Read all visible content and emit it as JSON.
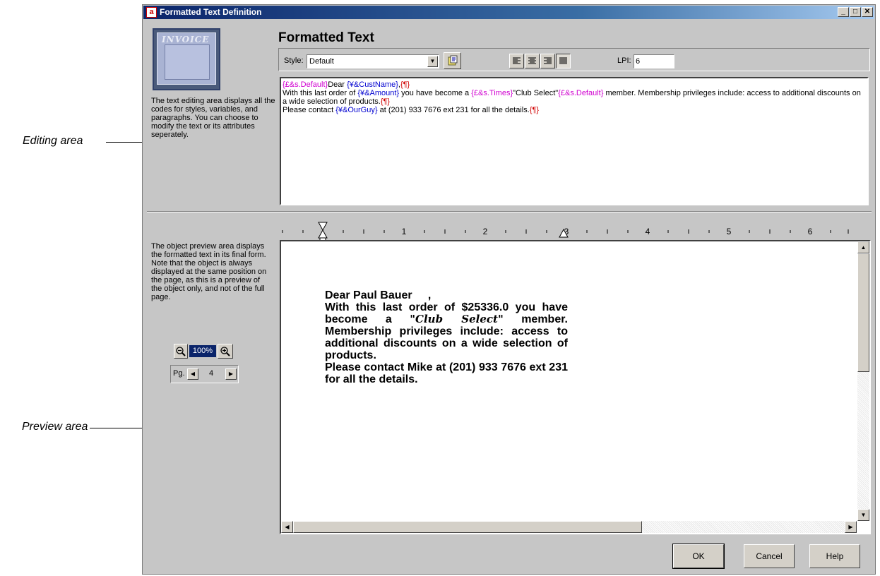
{
  "callouts": {
    "editing_label": "Editing area",
    "preview_label": "Preview area"
  },
  "window": {
    "title": "Formatted Text Definition",
    "controls": {
      "minimize": "_",
      "maximize": "□",
      "close": "✕"
    }
  },
  "thumbnail": {
    "label": "INVOICE"
  },
  "help": {
    "editing_text": "The text editing area displays all the codes for styles, variables, and paragraphs. You can choose to modify the text or its attributes seperately.",
    "preview_text": "The object preview area displays the formatted text in its final form. Note that the object is always displayed at the same position on the page, as this is a preview of the object only, and not of the full page."
  },
  "heading": "Formatted Text",
  "toolbar": {
    "style_label": "Style:",
    "style_value": "Default",
    "lpi_label": "LPI:",
    "lpi_value": "6",
    "align_buttons": [
      "align-left",
      "align-center",
      "align-right",
      "justify"
    ],
    "active_alignment": "justify"
  },
  "editor": {
    "line1": [
      {
        "t": "{£&s.Default}",
        "c": "mag"
      },
      {
        "t": "Dear ",
        "c": "txt"
      },
      {
        "t": "{¥&CustName}",
        "c": "blue"
      },
      {
        "t": ",",
        "c": "txt"
      },
      {
        "t": "{¶}",
        "c": "red"
      }
    ],
    "line2": [
      {
        "t": "With this last order of ",
        "c": "txt"
      },
      {
        "t": "{¥&Amount}",
        "c": "blue"
      },
      {
        "t": " you have become a ",
        "c": "txt"
      },
      {
        "t": "{£&s.Times}",
        "c": "mag"
      },
      {
        "t": "\"Club Select\"",
        "c": "txt"
      },
      {
        "t": "{£&s.Default}",
        "c": "mag"
      },
      {
        "t": " member. Membership privileges include: access to additional discounts on a wide selection of products.",
        "c": "txt"
      },
      {
        "t": "{¶}",
        "c": "red"
      }
    ],
    "line3": [
      {
        "t": "Please contact ",
        "c": "txt"
      },
      {
        "t": "{¥&OurGuy}",
        "c": "blue"
      },
      {
        "t": " at (201) 933 7676  ext 231 for all the details.",
        "c": "txt"
      },
      {
        "t": "{¶}",
        "c": "red"
      }
    ]
  },
  "ruler": {
    "numbers": [
      "1",
      "2",
      "3",
      "4",
      "5",
      "6"
    ]
  },
  "preview": {
    "line1": "Dear Paul Bauer     ,",
    "line2a": "With this last order of $25336.0 you have become a ",
    "club": "\"Club Select\"",
    "line2b": " member. Membership privileges include: access to additional discounts on a wide selection of products.",
    "line3": "Please contact Mike at (201) 933 7676 ext 231 for all the details."
  },
  "zoom": {
    "value": "100%"
  },
  "page_nav": {
    "label": "Pg.",
    "value": "4"
  },
  "buttons": {
    "ok": "OK",
    "cancel": "Cancel",
    "help": "Help"
  }
}
